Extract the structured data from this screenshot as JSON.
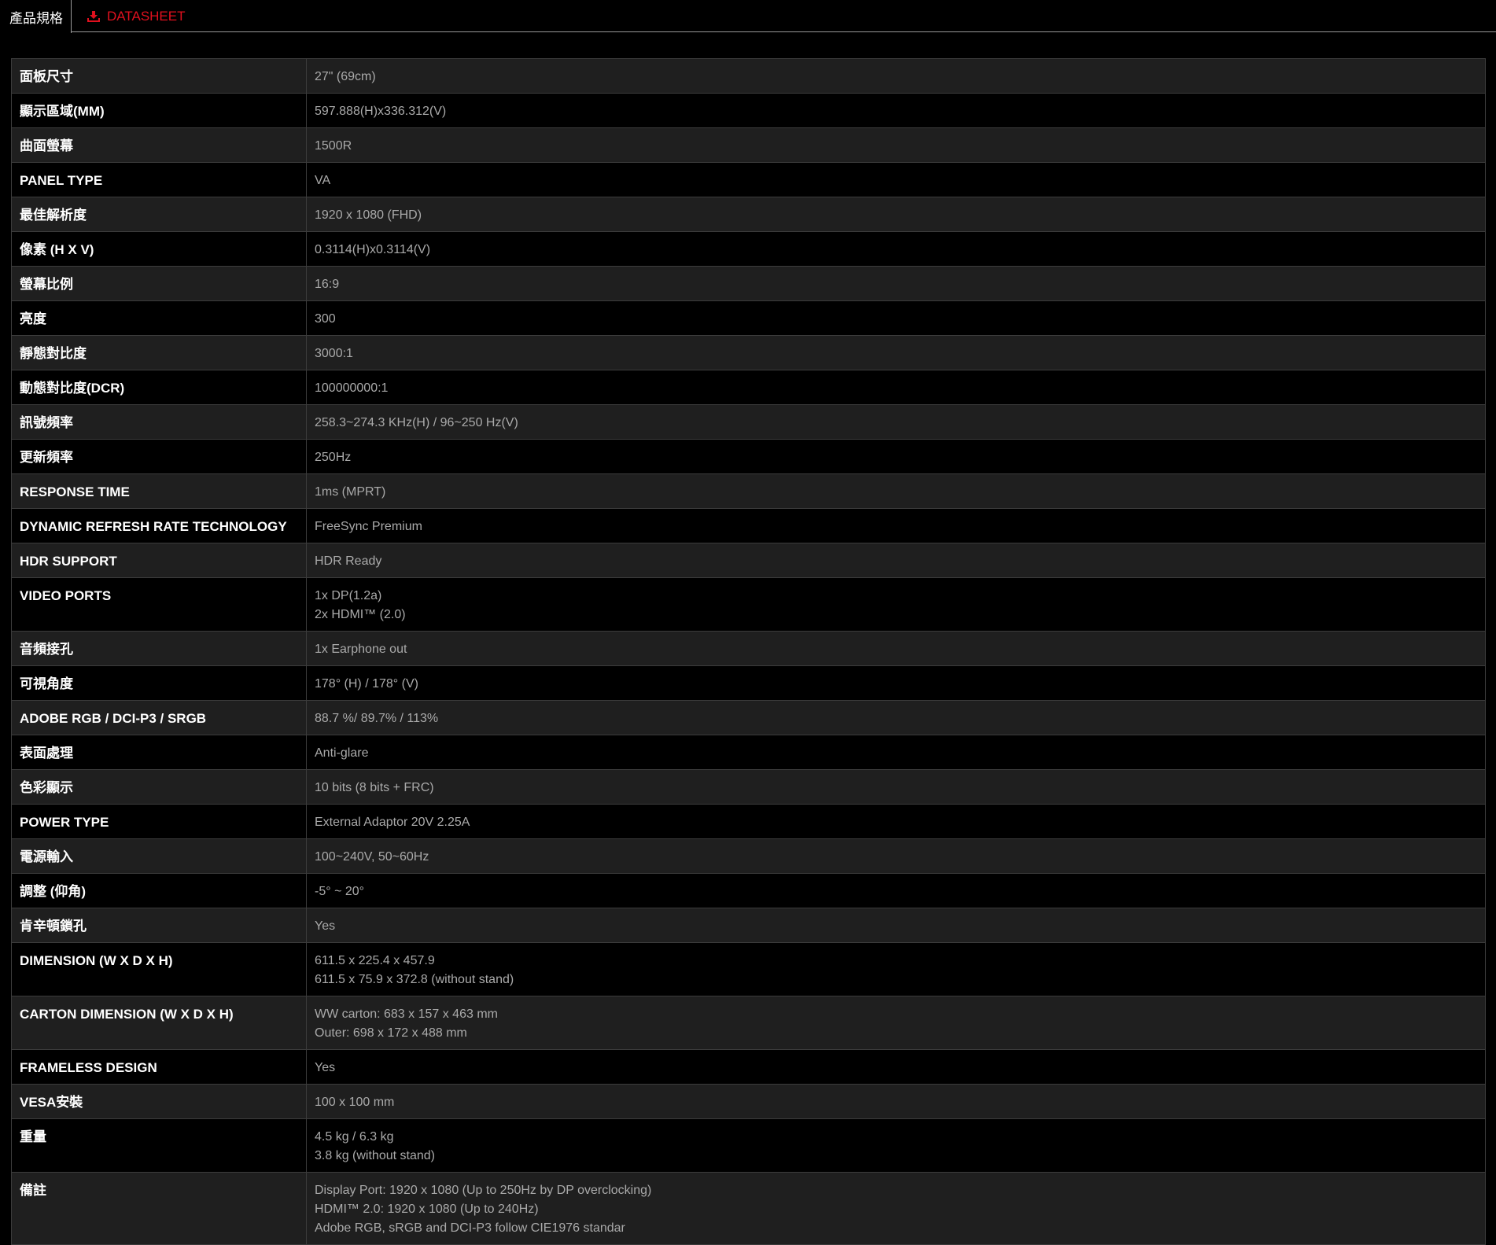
{
  "tabs": {
    "specs_label": "產品規格",
    "datasheet_label": "DATASHEET",
    "datasheet_icon": "download-icon",
    "accent_color": "#e0101e"
  },
  "specs": [
    {
      "label": "面板尺寸",
      "values": [
        "27\" (69cm)"
      ]
    },
    {
      "label": "顯示區域(MM)",
      "values": [
        "597.888(H)x336.312(V)"
      ]
    },
    {
      "label": "曲面螢幕",
      "values": [
        "1500R"
      ]
    },
    {
      "label": "PANEL TYPE",
      "values": [
        "VA"
      ]
    },
    {
      "label": "最佳解析度",
      "values": [
        "1920 x 1080 (FHD)"
      ]
    },
    {
      "label": "像素 (H X V)",
      "values": [
        "0.3114(H)x0.3114(V)"
      ]
    },
    {
      "label": "螢幕比例",
      "values": [
        "16:9"
      ]
    },
    {
      "label": "亮度",
      "values": [
        "300"
      ]
    },
    {
      "label": "靜態對比度",
      "values": [
        "3000:1"
      ]
    },
    {
      "label": "動態對比度(DCR)",
      "values": [
        "100000000:1"
      ]
    },
    {
      "label": "訊號頻率",
      "values": [
        "258.3~274.3 KHz(H) / 96~250 Hz(V)"
      ]
    },
    {
      "label": "更新頻率",
      "values": [
        "250Hz"
      ]
    },
    {
      "label": "RESPONSE TIME",
      "values": [
        "1ms (MPRT)"
      ]
    },
    {
      "label": "DYNAMIC REFRESH RATE TECHNOLOGY",
      "values": [
        "FreeSync Premium"
      ]
    },
    {
      "label": "HDR SUPPORT",
      "values": [
        "HDR Ready"
      ]
    },
    {
      "label": "VIDEO PORTS",
      "values": [
        "1x DP(1.2a)",
        "2x HDMI™ (2.0)"
      ]
    },
    {
      "label": "音頻接孔",
      "values": [
        "1x Earphone out"
      ]
    },
    {
      "label": "可視角度",
      "values": [
        "178° (H) / 178° (V)"
      ]
    },
    {
      "label": "ADOBE RGB / DCI-P3 / SRGB",
      "values": [
        "88.7 %/ 89.7% / 113%"
      ]
    },
    {
      "label": "表面處理",
      "values": [
        "Anti-glare"
      ]
    },
    {
      "label": "色彩顯示",
      "values": [
        "10 bits (8 bits + FRC)"
      ]
    },
    {
      "label": "POWER TYPE",
      "values": [
        "External Adaptor 20V 2.25A"
      ]
    },
    {
      "label": "電源輸入",
      "values": [
        "100~240V, 50~60Hz"
      ]
    },
    {
      "label": "調整 (仰角)",
      "values": [
        "-5° ~ 20°"
      ]
    },
    {
      "label": "肯辛頓鎖孔",
      "values": [
        "Yes"
      ]
    },
    {
      "label": "DIMENSION (W X D X H)",
      "values": [
        "611.5 x 225.4 x 457.9",
        "611.5 x 75.9 x 372.8 (without stand)"
      ]
    },
    {
      "label": "CARTON DIMENSION (W X D X H)",
      "values": [
        "WW carton: 683 x 157 x 463 mm",
        "Outer: 698 x 172 x 488 mm"
      ]
    },
    {
      "label": "FRAMELESS DESIGN",
      "values": [
        "Yes"
      ]
    },
    {
      "label": "VESA安裝",
      "values": [
        "100 x 100 mm"
      ]
    },
    {
      "label": "重量",
      "values": [
        "4.5 kg / 6.3 kg",
        "3.8 kg (without stand)"
      ]
    },
    {
      "label": "備註",
      "values": [
        "Display Port: 1920 x 1080 (Up to 250Hz by DP overclocking)",
        "HDMI™ 2.0: 1920 x 1080 (Up to 240Hz)",
        "Adobe RGB, sRGB and DCI-P3 follow CIE1976 standar"
      ]
    }
  ]
}
